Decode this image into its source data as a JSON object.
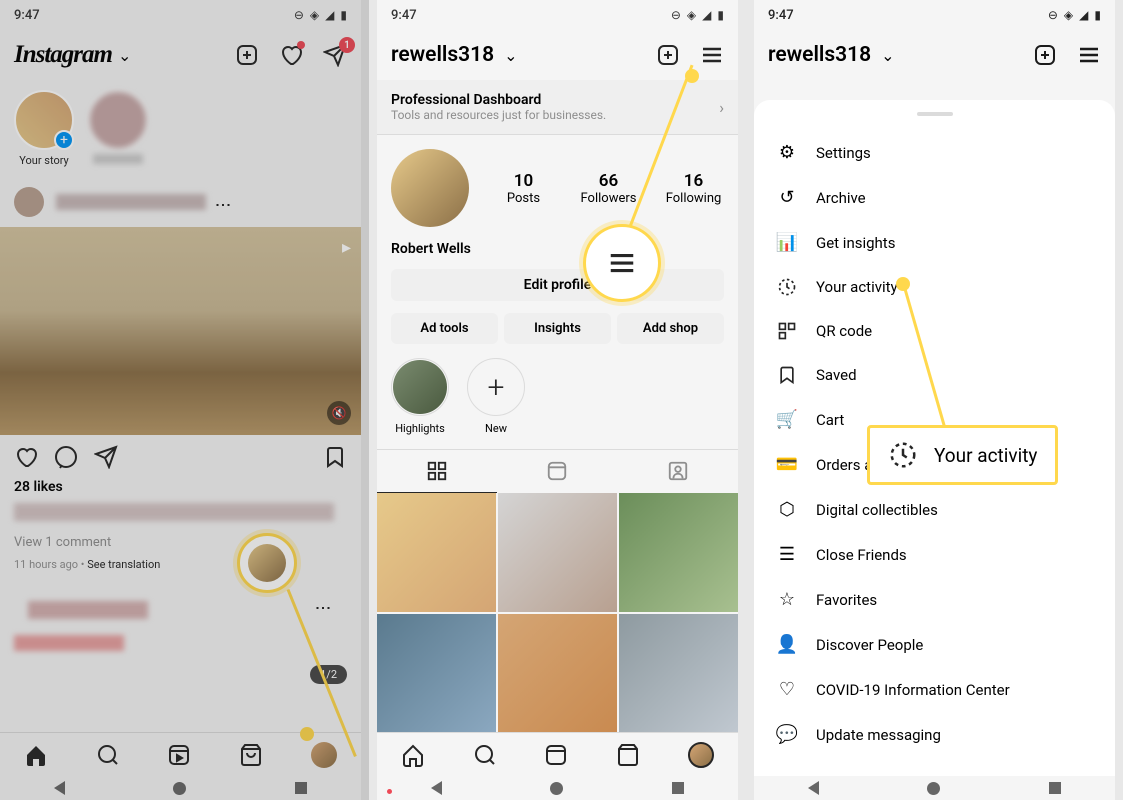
{
  "status": {
    "time": "9:47"
  },
  "phone1": {
    "logo": "Instagram",
    "dm_badge": "1",
    "story_your": "Your story",
    "likes": "28 likes",
    "view_comments": "View 1 comment",
    "time_ago": "11 hours ago",
    "see_trans": "See translation",
    "carousel": "1/2"
  },
  "phone2": {
    "username": "rewells318",
    "dash_title": "Professional Dashboard",
    "dash_sub": "Tools and resources just for businesses.",
    "stats": {
      "posts_n": "10",
      "posts_l": "Posts",
      "followers_n": "66",
      "followers_l": "Followers",
      "following_n": "16",
      "following_l": "Following"
    },
    "display_name": "Robert Wells",
    "edit": "Edit profile",
    "ad_tools": "Ad tools",
    "insights": "Insights",
    "add_shop": "Add shop",
    "hl1": "Highlights",
    "hl2": "New"
  },
  "phone3": {
    "username": "rewells318",
    "menu": {
      "settings": "Settings",
      "archive": "Archive",
      "insights": "Get insights",
      "activity": "Your activity",
      "qr": "QR code",
      "saved": "Saved",
      "cart": "Cart",
      "orders": "Orders and payments",
      "digital": "Digital collectibles",
      "close_friends": "Close Friends",
      "favorites": "Favorites",
      "discover": "Discover People",
      "covid": "COVID-19 Information Center",
      "messaging": "Update messaging"
    },
    "callout": "Your activity"
  }
}
